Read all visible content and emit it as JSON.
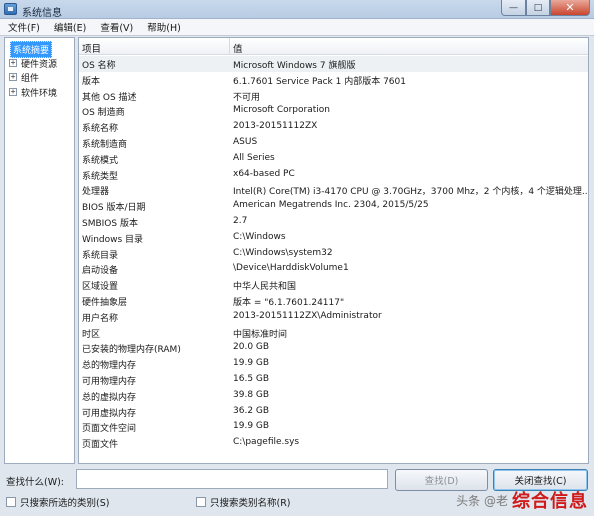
{
  "window": {
    "title": "系统信息",
    "buttons": {
      "minimize": "—",
      "maximize": "□",
      "close": "✕"
    }
  },
  "menu": [
    "文件(F)",
    "编辑(E)",
    "查看(V)",
    "帮助(H)"
  ],
  "tree": {
    "root": "系统摘要",
    "children": [
      {
        "expander": "+",
        "label": "硬件资源"
      },
      {
        "expander": "+",
        "label": "组件"
      },
      {
        "expander": "+",
        "label": "软件环境"
      }
    ]
  },
  "list": {
    "headers": {
      "item": "项目",
      "value": "值"
    },
    "rows": [
      {
        "name": "OS 名称",
        "value": "Microsoft Windows 7 旗舰版"
      },
      {
        "name": "版本",
        "value": "6.1.7601 Service Pack 1 内部版本 7601"
      },
      {
        "name": "其他 OS 描述",
        "value": "不可用"
      },
      {
        "name": "OS 制造商",
        "value": "Microsoft Corporation"
      },
      {
        "name": "系统名称",
        "value": "2013-20151112ZX"
      },
      {
        "name": "系统制造商",
        "value": "ASUS"
      },
      {
        "name": "系统模式",
        "value": "All Series"
      },
      {
        "name": "系统类型",
        "value": "x64-based PC"
      },
      {
        "name": "处理器",
        "value": "Intel(R) Core(TM) i3-4170 CPU @ 3.70GHz，3700 Mhz，2 个内核，4 个逻辑处理..."
      },
      {
        "name": "BIOS 版本/日期",
        "value": "American Megatrends Inc. 2304, 2015/5/25"
      },
      {
        "name": "SMBIOS 版本",
        "value": "2.7"
      },
      {
        "name": "Windows 目录",
        "value": "C:\\Windows"
      },
      {
        "name": "系统目录",
        "value": "C:\\Windows\\system32"
      },
      {
        "name": "启动设备",
        "value": "\\Device\\HarddiskVolume1"
      },
      {
        "name": "区域设置",
        "value": "中华人民共和国"
      },
      {
        "name": "硬件抽象层",
        "value": "版本 = \"6.1.7601.24117\""
      },
      {
        "name": "用户名称",
        "value": "2013-20151112ZX\\Administrator"
      },
      {
        "name": "时区",
        "value": "中国标准时间"
      },
      {
        "name": "已安装的物理内存(RAM)",
        "value": "20.0 GB"
      },
      {
        "name": "总的物理内存",
        "value": "19.9 GB"
      },
      {
        "name": "可用物理内存",
        "value": "16.5 GB"
      },
      {
        "name": "总的虚拟内存",
        "value": "39.8 GB"
      },
      {
        "name": "可用虚拟内存",
        "value": "36.2 GB"
      },
      {
        "name": "页面文件空间",
        "value": "19.9 GB"
      },
      {
        "name": "页面文件",
        "value": "C:\\pagefile.sys"
      }
    ]
  },
  "find": {
    "label": "查找什么(W):",
    "input_value": "",
    "find_button": "查找(D)",
    "close_find_button": "关闭查找(C)",
    "checkbox_selected_category": "只搜索所选的类别(S)",
    "checkbox_category_names": "只搜索类别名称(R)"
  },
  "watermark": {
    "small": "头条 @老",
    "big": "综合信息"
  }
}
